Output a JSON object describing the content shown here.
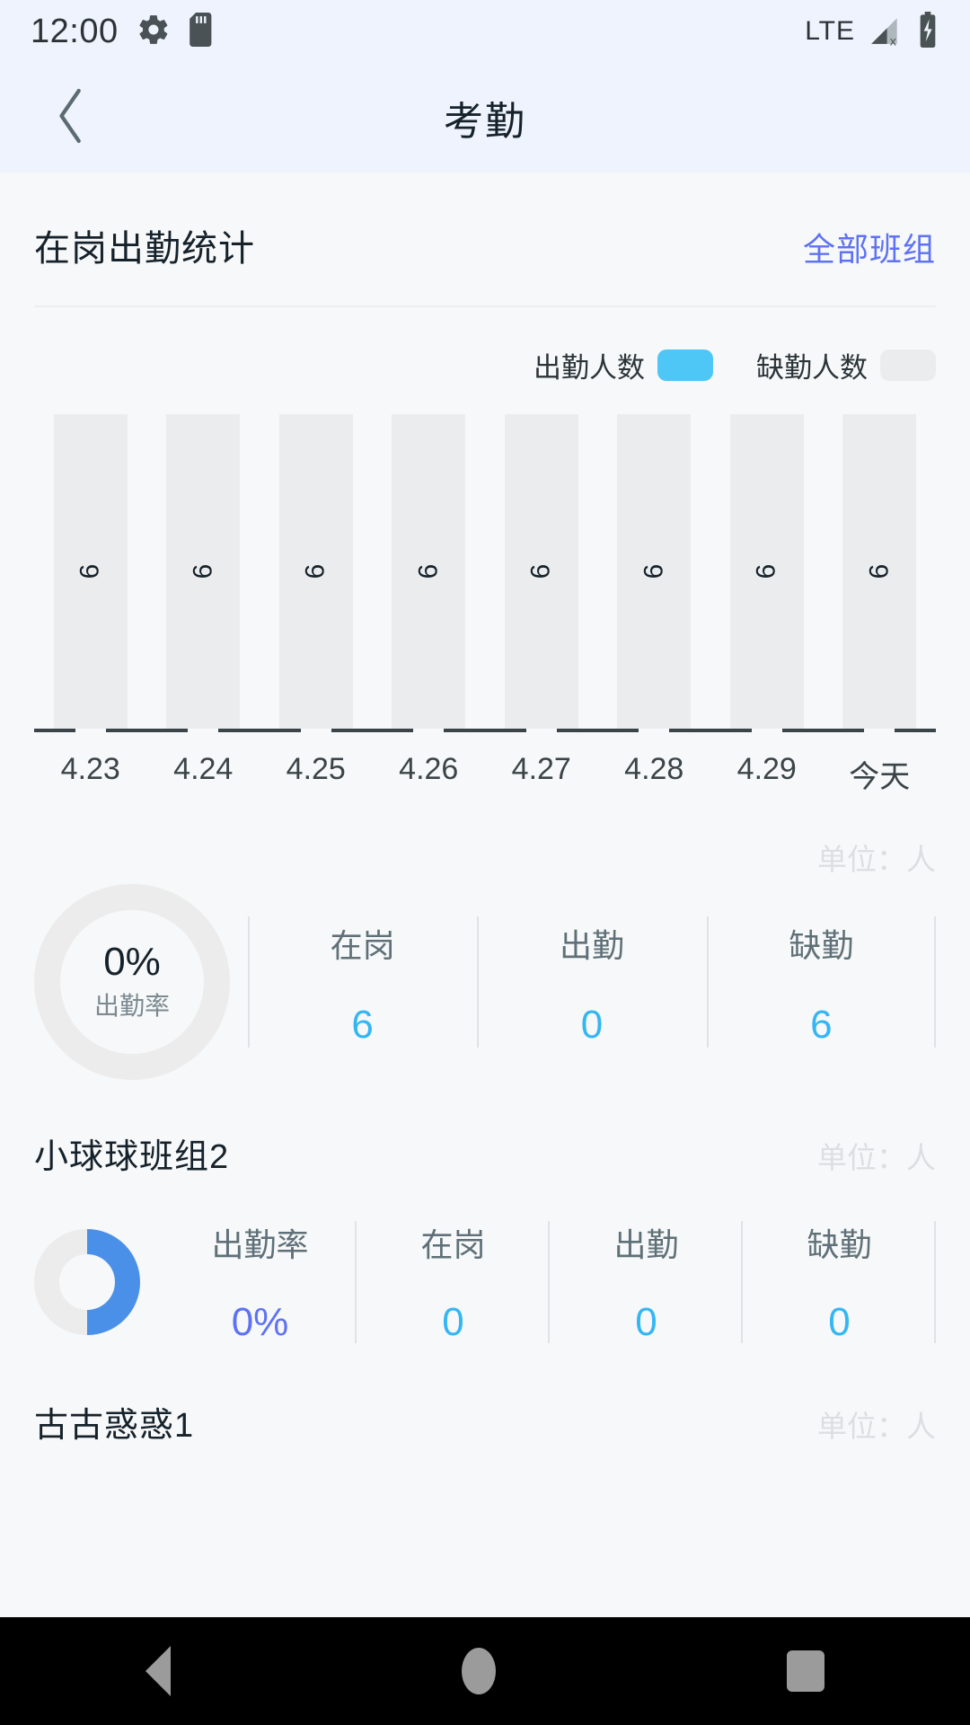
{
  "statusbar": {
    "time": "12:00",
    "icons_left": [
      "gear-icon",
      "sd-card-icon"
    ],
    "network": "LTE",
    "icons_right": [
      "signal-no-service-icon",
      "battery-charging-icon"
    ]
  },
  "titlebar": {
    "back_icon": "chevron-left-icon",
    "title": "考勤"
  },
  "section": {
    "title": "在岗出勤统计",
    "link": "全部班组"
  },
  "legend": {
    "present_label": "出勤人数",
    "present_color": "#4ec7f6",
    "absent_label": "缺勤人数",
    "absent_color": "#ebeced"
  },
  "chart_data": {
    "type": "bar",
    "title": "在岗出勤统计",
    "categories": [
      "4.23",
      "4.24",
      "4.25",
      "4.26",
      "4.27",
      "4.28",
      "4.29",
      "今天"
    ],
    "series": [
      {
        "name": "出勤人数",
        "values": [
          0,
          0,
          0,
          0,
          0,
          0,
          0,
          0
        ],
        "color": "#4ec7f6"
      },
      {
        "name": "缺勤人数",
        "values": [
          6,
          6,
          6,
          6,
          6,
          6,
          6,
          6
        ],
        "color": "#ebeced"
      }
    ],
    "bar_labels": [
      "6",
      "6",
      "6",
      "6",
      "6",
      "6",
      "6",
      "6"
    ],
    "stacked": true,
    "ylim": [
      0,
      6
    ],
    "xlabel": "",
    "ylabel": "",
    "unit": "单位：人",
    "grid": false,
    "legend_position": "top-right"
  },
  "summary": {
    "unit": "单位：人",
    "rate_value": "0%",
    "rate_caption": "出勤率",
    "stats": [
      {
        "label": "在岗",
        "value": "6"
      },
      {
        "label": "出勤",
        "value": "0"
      },
      {
        "label": "缺勤",
        "value": "6"
      }
    ]
  },
  "groups": [
    {
      "name": "小球球班组2",
      "unit": "单位：人",
      "donut_percent": 50,
      "donut_color": "#4a90e8",
      "stats": [
        {
          "label": "出勤率",
          "value": "0%",
          "accent": true
        },
        {
          "label": "在岗",
          "value": "0",
          "accent": false
        },
        {
          "label": "出勤",
          "value": "0",
          "accent": false
        },
        {
          "label": "缺勤",
          "value": "0",
          "accent": false
        }
      ]
    },
    {
      "name": "古古惑惑1",
      "unit": "单位：人"
    }
  ],
  "navbar": {
    "back": "nav-back-icon",
    "home": "nav-home-icon",
    "recents": "nav-recents-icon"
  }
}
